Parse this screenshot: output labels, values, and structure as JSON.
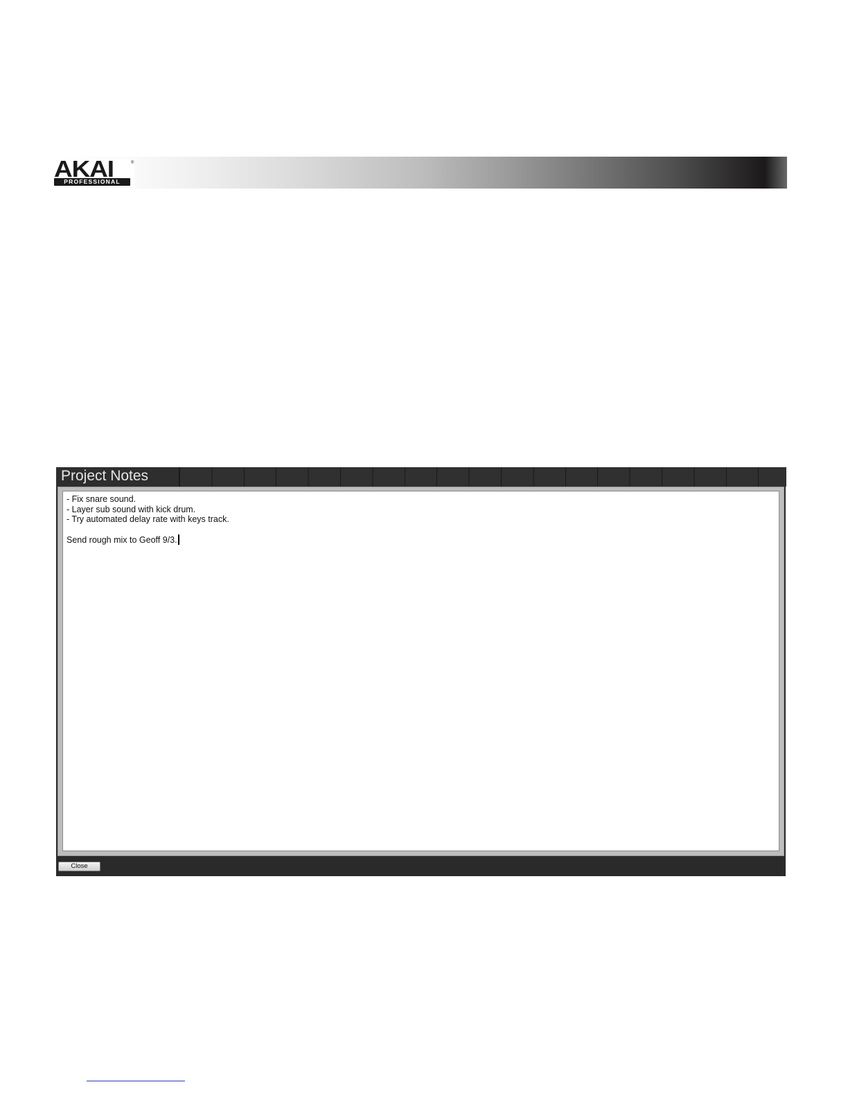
{
  "header": {
    "logo": {
      "name": "AKAI",
      "sub": "PROFESSIONAL",
      "reg": "®"
    }
  },
  "project_notes": {
    "title": "Project Notes",
    "lines": [
      "- Fix snare sound.",
      "- Layer sub sound with kick drum.",
      "- Try automated delay rate with keys track.",
      "",
      "Send rough mix to Geoff 9/3."
    ],
    "close_label": "Close"
  }
}
